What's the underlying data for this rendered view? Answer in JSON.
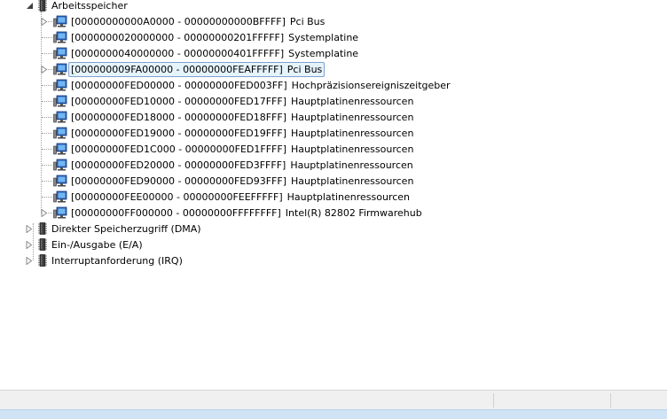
{
  "tree": {
    "category": {
      "label": "Arbeitsspeicher",
      "expanded": true,
      "children": [
        {
          "range": "[00000000000A0000 - 00000000000BFFFF]",
          "name": "Pci Bus",
          "has_children": true
        },
        {
          "range": "[0000000020000000 - 00000000201FFFFF]",
          "name": "Systemplatine",
          "has_children": false
        },
        {
          "range": "[0000000040000000 - 00000000401FFFFF]",
          "name": "Systemplatine",
          "has_children": false
        },
        {
          "range": "[000000009FA00000 - 00000000FEAFFFFF]",
          "name": "Pci Bus",
          "has_children": true,
          "selected": true
        },
        {
          "range": "[00000000FED00000 - 00000000FED003FF]",
          "name": "Hochpräzisionsereigniszeitgeber",
          "has_children": false
        },
        {
          "range": "[00000000FED10000 - 00000000FED17FFF]",
          "name": "Hauptplatinenressourcen",
          "has_children": false
        },
        {
          "range": "[00000000FED18000 - 00000000FED18FFF]",
          "name": "Hauptplatinenressourcen",
          "has_children": false
        },
        {
          "range": "[00000000FED19000 - 00000000FED19FFF]",
          "name": "Hauptplatinenressourcen",
          "has_children": false
        },
        {
          "range": "[00000000FED1C000 - 00000000FED1FFFF]",
          "name": "Hauptplatinenressourcen",
          "has_children": false
        },
        {
          "range": "[00000000FED20000 - 00000000FED3FFFF]",
          "name": "Hauptplatinenressourcen",
          "has_children": false
        },
        {
          "range": "[00000000FED90000 - 00000000FED93FFF]",
          "name": "Hauptplatinenressourcen",
          "has_children": false
        },
        {
          "range": "[00000000FEE00000 - 00000000FEEFFFFF]",
          "name": "Hauptplatinenressourcen",
          "has_children": false
        },
        {
          "range": "[00000000FF000000 - 00000000FFFFFFFF]",
          "name": "Intel(R) 82802 Firmwarehub",
          "has_children": true
        }
      ]
    },
    "other_categories": [
      {
        "label": "Direkter Speicherzugriff (DMA)",
        "expanded": false
      },
      {
        "label": "Ein-/Ausgabe (E/A)",
        "expanded": false
      },
      {
        "label": "Interruptanforderung (IRQ)",
        "expanded": false
      }
    ]
  },
  "colors": {
    "selection_bg": "#e5f3fb",
    "selection_border": "#7da2ce",
    "statusbar_bg": "#f0f0f0",
    "bottom_strip": "#cfe3f5"
  },
  "icons": {
    "category": "memory-chip-icon",
    "device": "computer-device-icon",
    "expand": "triangle-right-icon",
    "collapse": "triangle-down-icon"
  }
}
